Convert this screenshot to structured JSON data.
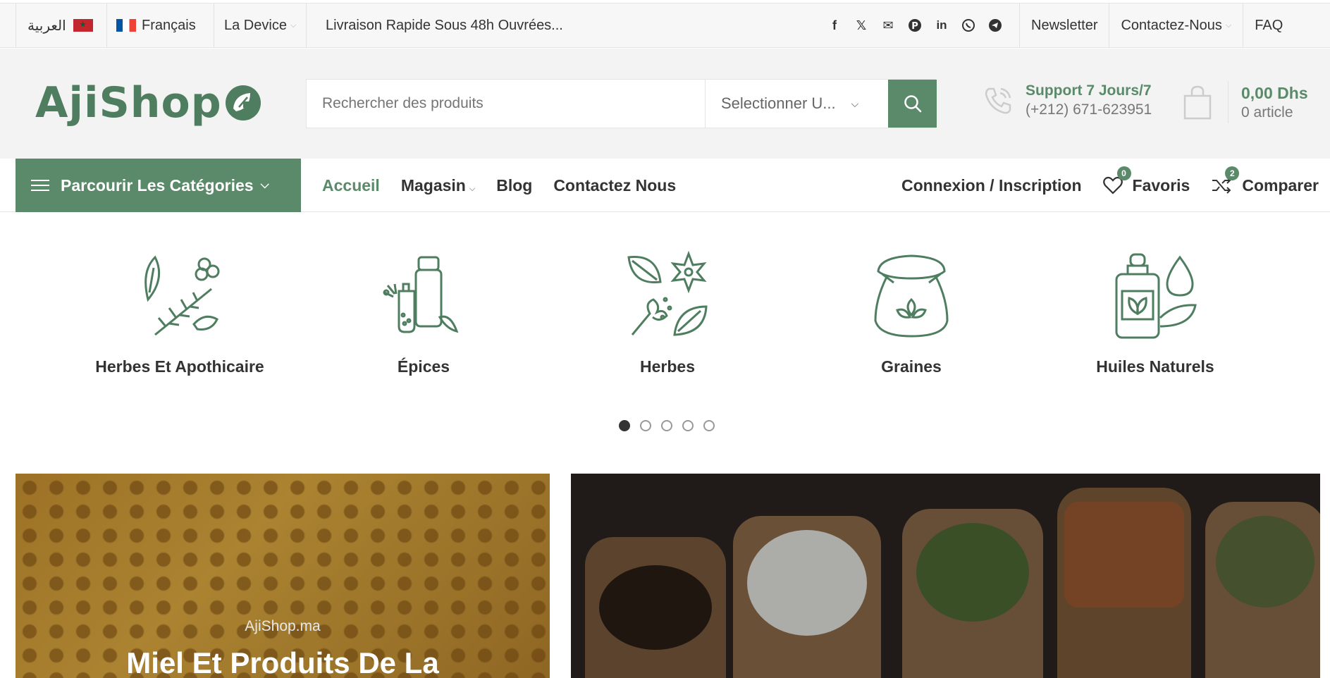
{
  "topbar": {
    "lang_ar": "العربية",
    "lang_fr": "Français",
    "currency": "La Device",
    "promo": "Livraison Rapide Sous 48h Ouvrées...",
    "social_icons": [
      "facebook-icon",
      "x-icon",
      "mail-icon",
      "pinterest-icon",
      "linkedin-icon",
      "whatsapp-icon",
      "telegram-icon"
    ],
    "links": {
      "newsletter": "Newsletter",
      "contact": "Contactez-Nous",
      "faq": "FAQ"
    }
  },
  "header": {
    "logo": "AjiShop",
    "search_placeholder": "Rechercher des produits",
    "category_select": "Selectionner U...",
    "support_title": "Support 7 Jours/7",
    "support_phone": "(+212) 671-623951",
    "cart_amount": "0,00 Dhs",
    "cart_count": "0 article"
  },
  "nav": {
    "browse": "Parcourir Les Catégories",
    "links": [
      "Accueil",
      "Magasin",
      "Blog",
      "Contactez Nous"
    ],
    "login": "Connexion / Inscription",
    "favorites": "Favoris",
    "favorites_count": "0",
    "compare": "Comparer",
    "compare_count": "2"
  },
  "categories": [
    {
      "label": "Herbes Et Apothicaire",
      "icon": "herbs-apothecary-icon"
    },
    {
      "label": "Épices",
      "icon": "spices-icon"
    },
    {
      "label": "Herbes",
      "icon": "herbs-icon"
    },
    {
      "label": "Graines",
      "icon": "grains-sack-icon"
    },
    {
      "label": "Huiles Naturels",
      "icon": "oil-bottle-icon"
    }
  ],
  "carousel": {
    "pages": 5,
    "active": 1
  },
  "banners": [
    {
      "subtitle": "AjiShop.ma",
      "title": "Miel Et Produits De La"
    },
    {
      "subtitle": "",
      "title": ""
    }
  ],
  "colors": {
    "brand_green": "#5a8a6a",
    "text": "#333333"
  }
}
